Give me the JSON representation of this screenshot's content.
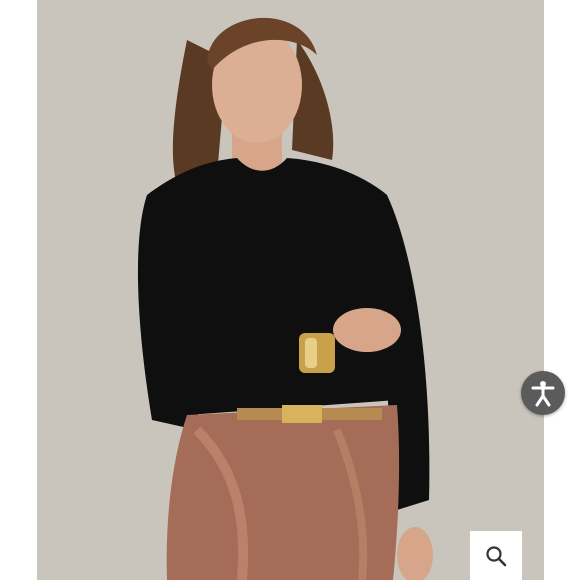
{
  "product_image": {
    "alt_visible": "",
    "background_color": "#c9c5bd"
  },
  "controls": {
    "accessibility_icon": "accessibility-icon",
    "accessibility_color": "#5b5b5b",
    "zoom_icon": "magnifier-icon"
  }
}
